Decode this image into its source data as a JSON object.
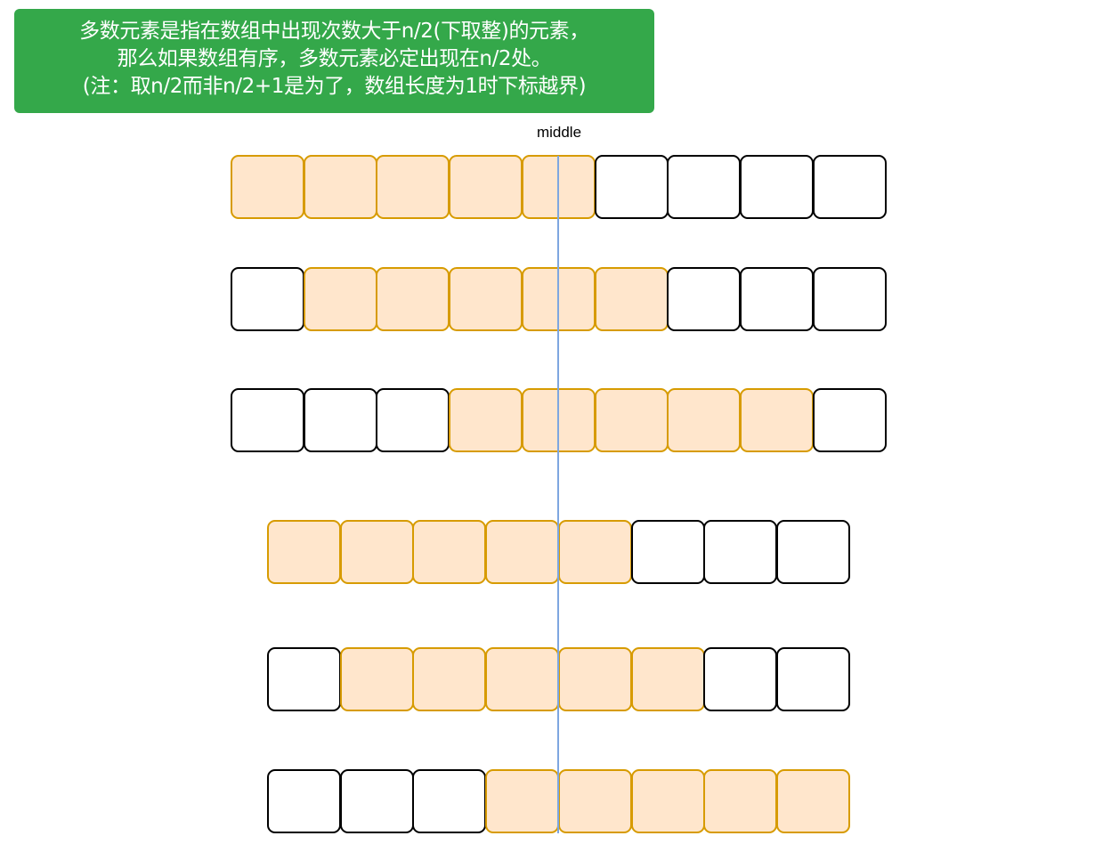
{
  "note": {
    "lines": [
      "多数元素是指在数组中出现次数大于n/2(下取整)的元素，",
      "那么如果数组有序，多数元素必定出现在n/2处。",
      "(注：取n/2而非n/2+1是为了，数组长度为1时下标越界)"
    ]
  },
  "middle_label": "middle",
  "colors": {
    "note_bg": "#34a84a",
    "filled_cell_bg": "#ffe6cc",
    "filled_cell_border": "#d79b00",
    "empty_cell_border": "#000000",
    "middle_line": "#7ea6e0"
  },
  "arrays": [
    {
      "length": 9,
      "majority_start": 0,
      "majority_count": 5
    },
    {
      "length": 9,
      "majority_start": 1,
      "majority_count": 5
    },
    {
      "length": 9,
      "majority_start": 3,
      "majority_count": 5
    },
    {
      "length": 8,
      "majority_start": 0,
      "majority_count": 5
    },
    {
      "length": 8,
      "majority_start": 1,
      "majority_count": 5
    },
    {
      "length": 8,
      "majority_start": 3,
      "majority_count": 5
    }
  ]
}
